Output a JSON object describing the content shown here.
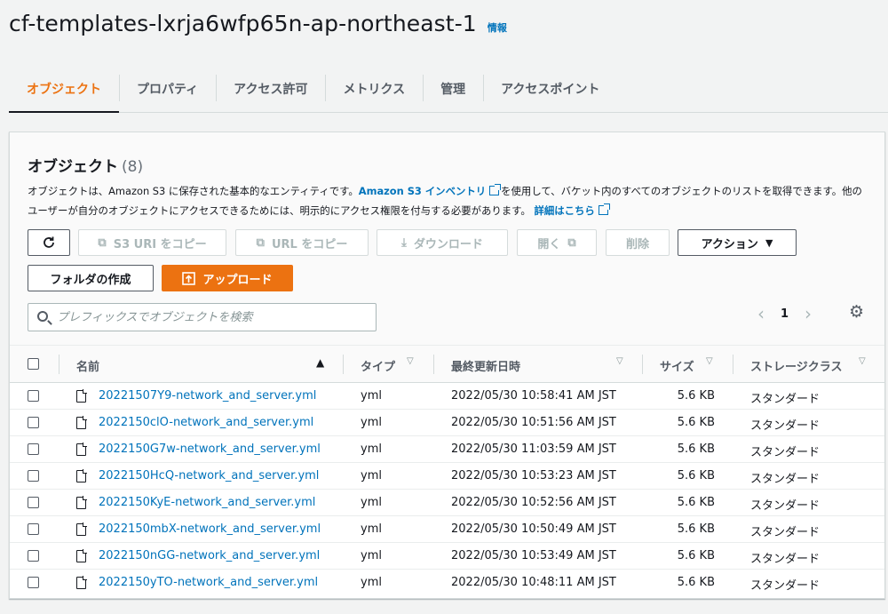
{
  "header": {
    "title": "cf-templates-lxrja6wfp65n-ap-northeast-1",
    "info": "情報"
  },
  "tabs": [
    {
      "label": "オブジェクト",
      "active": true
    },
    {
      "label": "プロパティ"
    },
    {
      "label": "アクセス許可"
    },
    {
      "label": "メトリクス"
    },
    {
      "label": "管理"
    },
    {
      "label": "アクセスポイント"
    }
  ],
  "panel": {
    "title": "オブジェクト",
    "count": "(8)",
    "desc_part1": "オブジェクトは、Amazon S3 に保存された基本的なエンティティです。",
    "inventory_link": "Amazon S3 インベントリ",
    "desc_part2": "を使用して、バケット内のすべてのオブジェクトのリストを取得できます。他のユーザーが自分のオブジェクトにアクセスできるためには、明示的にアクセス権限を付与する必要があります。",
    "details_link": "詳細はこちら"
  },
  "toolbar": {
    "refresh_icon": "refresh-icon",
    "copy_s3_uri": "S3 URI をコピー",
    "copy_url": "URL をコピー",
    "download": "ダウンロード",
    "open": "開く",
    "delete": "削除",
    "actions": "アクション",
    "create_folder": "フォルダの作成",
    "upload": "アップロード"
  },
  "search": {
    "placeholder": "プレフィックスでオブジェクトを検索"
  },
  "pagination": {
    "current_page": "1"
  },
  "table": {
    "headers": {
      "name": "名前",
      "type": "タイプ",
      "modified": "最終更新日時",
      "size": "サイズ",
      "storage": "ストレージクラス"
    },
    "rows": [
      {
        "name": "20221507Y9-network_and_server.yml",
        "type": "yml",
        "modified": "2022/05/30 10:58:41 AM JST",
        "size": "5.6 KB",
        "storage": "スタンダード"
      },
      {
        "name": "2022150clO-network_and_server.yml",
        "type": "yml",
        "modified": "2022/05/30 10:51:56 AM JST",
        "size": "5.6 KB",
        "storage": "スタンダード"
      },
      {
        "name": "2022150G7w-network_and_server.yml",
        "type": "yml",
        "modified": "2022/05/30 11:03:59 AM JST",
        "size": "5.6 KB",
        "storage": "スタンダード"
      },
      {
        "name": "2022150HcQ-network_and_server.yml",
        "type": "yml",
        "modified": "2022/05/30 10:53:23 AM JST",
        "size": "5.6 KB",
        "storage": "スタンダード"
      },
      {
        "name": "2022150KyE-network_and_server.yml",
        "type": "yml",
        "modified": "2022/05/30 10:52:56 AM JST",
        "size": "5.6 KB",
        "storage": "スタンダード"
      },
      {
        "name": "2022150mbX-network_and_server.yml",
        "type": "yml",
        "modified": "2022/05/30 10:50:49 AM JST",
        "size": "5.6 KB",
        "storage": "スタンダード"
      },
      {
        "name": "2022150nGG-network_and_server.yml",
        "type": "yml",
        "modified": "2022/05/30 10:53:49 AM JST",
        "size": "5.6 KB",
        "storage": "スタンダード"
      },
      {
        "name": "2022150yTO-network_and_server.yml",
        "type": "yml",
        "modified": "2022/05/30 10:48:11 AM JST",
        "size": "5.6 KB",
        "storage": "スタンダード"
      }
    ]
  },
  "colors": {
    "accent": "#ec7211",
    "link": "#0073bb",
    "text": "#16191f"
  }
}
